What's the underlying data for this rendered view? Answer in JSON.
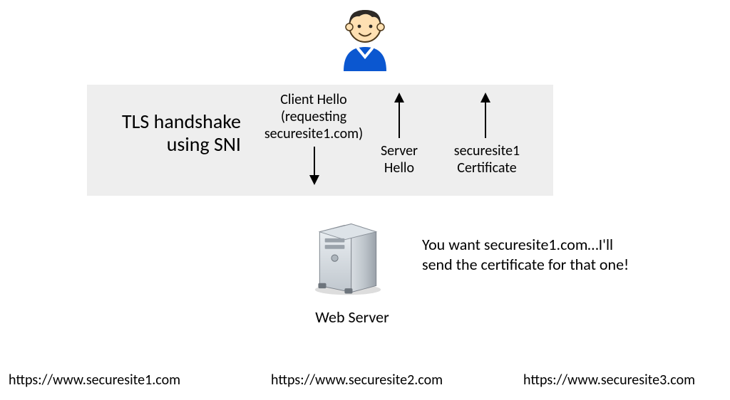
{
  "title": {
    "line1": "TLS handshake",
    "line2": "using SNI"
  },
  "messages": {
    "clientHello": {
      "line1": "Client Hello",
      "line2": "(requesting",
      "line3": "securesite1.com)"
    },
    "serverHello": {
      "line1": "Server",
      "line2": "Hello"
    },
    "certificate": {
      "line1": "securesite1",
      "line2": "Certificate"
    }
  },
  "serverLabel": "Web Server",
  "speech": {
    "line1": "You want securesite1.com…I'll",
    "line2": "send the certificate for that one!"
  },
  "urls": {
    "u1": "https://www.securesite1.com",
    "u2": "https://www.securesite2.com",
    "u3": "https://www.securesite3.com"
  }
}
